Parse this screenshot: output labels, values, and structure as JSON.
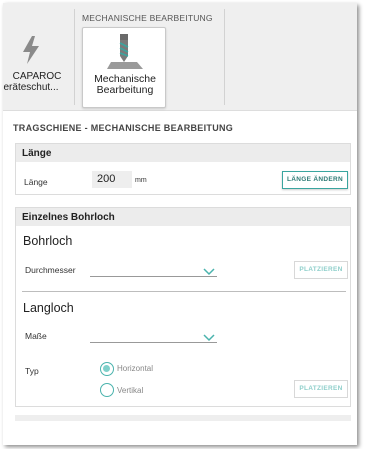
{
  "ribbon": {
    "tool1": {
      "line1": "CAPAROC",
      "line2": "eräteschut...",
      "icon": "lightning-bolt-icon"
    },
    "group_title": "MECHANISCHE BEARBEITUNG",
    "tool2": {
      "line1": "Mechanische",
      "line2": "Bearbeitung",
      "icon": "drill-bit-icon"
    }
  },
  "panel": {
    "title": "TRAGSCHIENE - MECHANISCHE BEARBEITUNG",
    "laenge_section": {
      "heading": "Länge",
      "field_label": "Länge",
      "value": "200",
      "unit": "mm",
      "button": "LÄNGE ÄNDERN"
    },
    "bohrloch_section": {
      "heading": "Einzelnes Bohrloch",
      "bohrloch": {
        "title": "Bohrloch",
        "label": "Durchmesser",
        "selected": "",
        "button": "PLATZIEREN"
      },
      "langloch": {
        "title": "Langloch",
        "label": "Maße",
        "selected": "",
        "typ_label": "Typ",
        "options": [
          "Horizontal",
          "Vertikal"
        ],
        "checked_option": "Horizontal",
        "button": "PLATZIEREN"
      }
    }
  },
  "colors": {
    "accent": "#3aa59f",
    "accent_light": "#7fd0ca",
    "ribbon_bg": "#efefef"
  }
}
